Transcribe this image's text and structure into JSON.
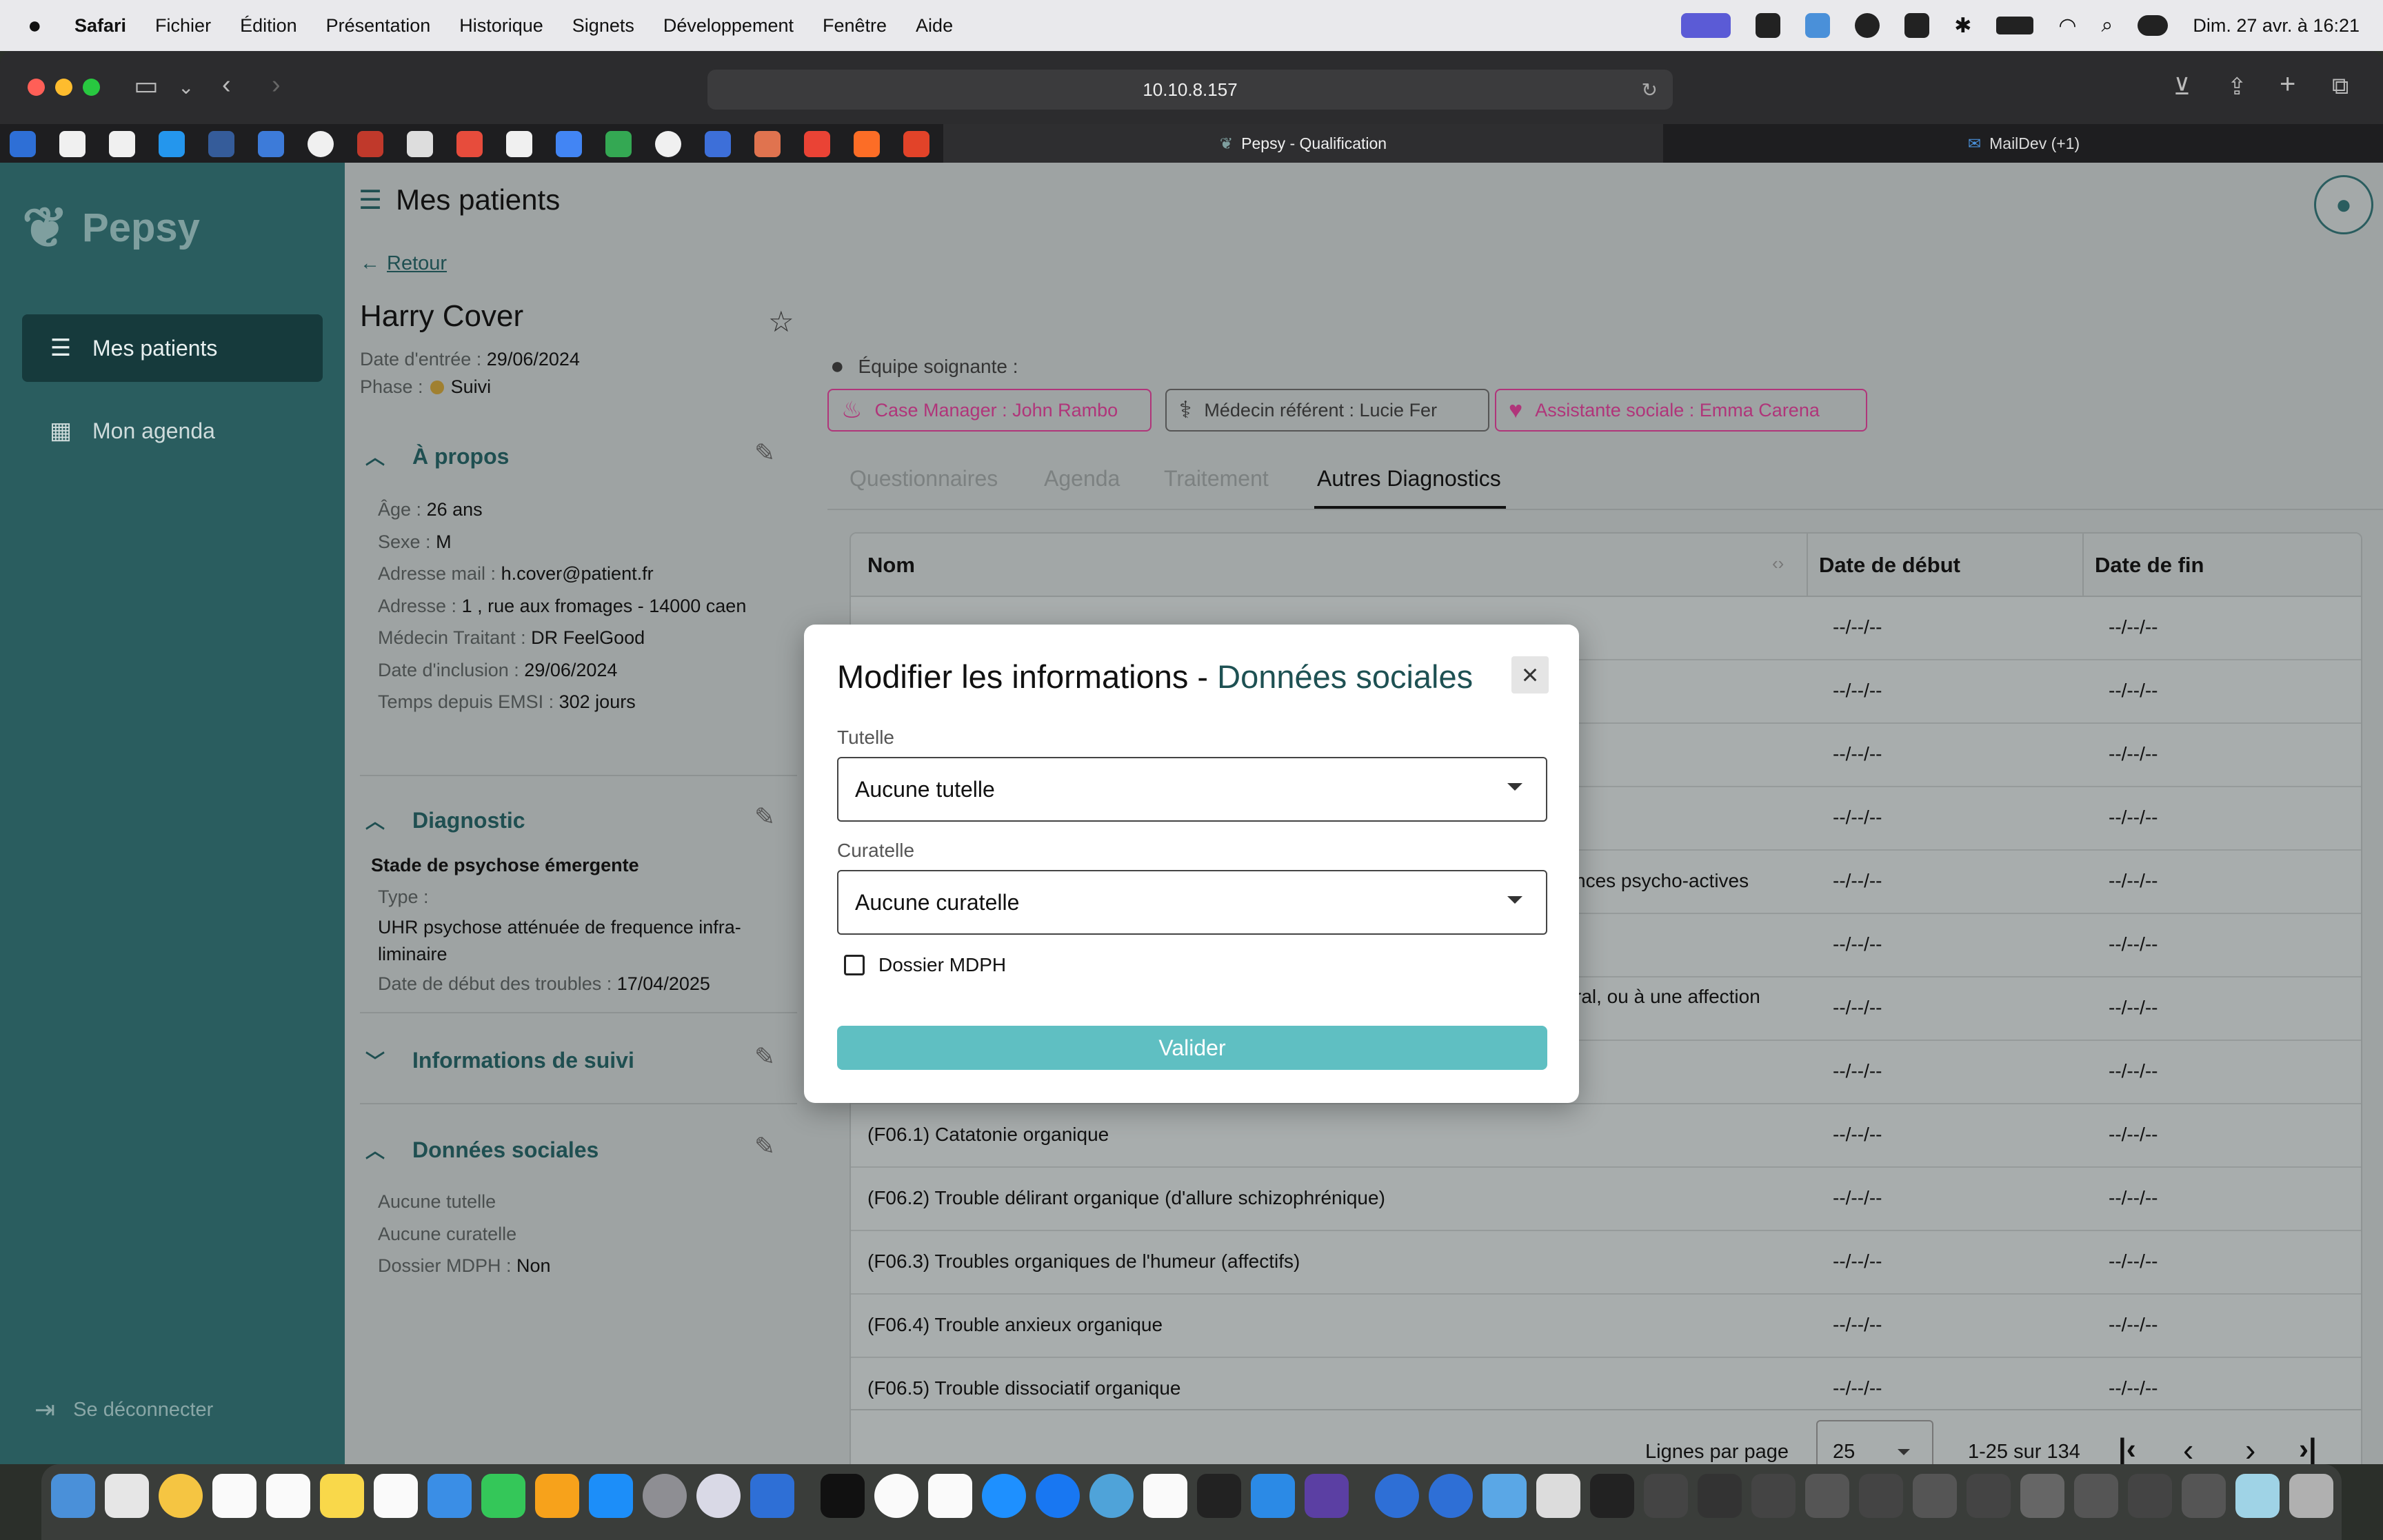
{
  "menubar": {
    "app": "Safari",
    "items": [
      "Fichier",
      "Édition",
      "Présentation",
      "Historique",
      "Signets",
      "Développement",
      "Fenêtre",
      "Aide"
    ],
    "clock": "Dim. 27 avr. à 16:21"
  },
  "browser": {
    "url": "10.10.8.157",
    "tabs": [
      {
        "label": "Pepsy - Qualification"
      },
      {
        "label": "MailDev (+1)"
      }
    ]
  },
  "sidebar": {
    "logo": "Pepsy",
    "items": [
      {
        "label": "Mes patients",
        "icon": "patients-list-icon"
      },
      {
        "label": "Mon agenda",
        "icon": "calendar-icon"
      }
    ],
    "logout": "Se déconnecter"
  },
  "page": {
    "title": "Mes patients",
    "back": "Retour"
  },
  "patient": {
    "name": "Harry Cover",
    "entry_label": "Date d'entrée :",
    "entry_value": "29/06/2024",
    "phase_label": "Phase :",
    "phase_value": "Suivi",
    "apropos": {
      "title": "À propos",
      "fields": [
        {
          "label": "Âge :",
          "value": "26 ans"
        },
        {
          "label": "Sexe :",
          "value": "M"
        },
        {
          "label": "Adresse mail :",
          "value": "h.cover@patient.fr"
        },
        {
          "label": "Adresse :",
          "value": "1 , rue aux fromages - 14000 caen"
        },
        {
          "label": "Médecin Traitant :",
          "value": "DR FeelGood"
        },
        {
          "label": "Date d'inclusion :",
          "value": "29/06/2024"
        },
        {
          "label": "Temps depuis EMSI :",
          "value": "302 jours"
        }
      ]
    },
    "diagnostic": {
      "title": "Diagnostic",
      "stage": "Stade de psychose émergente",
      "type_label": "Type :",
      "type_value_1": "UHR psychose atténuée de frequence infra-",
      "type_value_2": "liminaire",
      "start_label": "Date de début des troubles :",
      "start_value": "17/04/2025"
    },
    "suivi": {
      "title": "Informations de suivi"
    },
    "social": {
      "title": "Données sociales",
      "tutelle": "Aucune tutelle",
      "curatelle": "Aucune curatelle",
      "mdph_label": "Dossier MDPH  :",
      "mdph_value": "Non"
    }
  },
  "team": {
    "label": "Équipe soignante :",
    "chips": [
      {
        "label": "Case Manager : John Rambo",
        "color": "#b0357a"
      },
      {
        "label": "Médecin référent : Lucie Fer",
        "color": "#333333"
      },
      {
        "label": "Assistante sociale : Emma Carena",
        "color": "#b0357a"
      }
    ]
  },
  "tabs": [
    "Questionnaires",
    "Agenda",
    "Traitement",
    "Autres Diagnostics"
  ],
  "table": {
    "headers": [
      "Nom",
      "Date de début",
      "Date de fin"
    ],
    "rows": [
      {
        "name": "",
        "start": "--/--/--",
        "end": "--/--/--"
      },
      {
        "name": "",
        "start": "--/--/--",
        "end": "--/--/--"
      },
      {
        "name": "",
        "start": "--/--/--",
        "end": "--/--/--"
      },
      {
        "name": "",
        "start": "--/--/--",
        "end": "--/--/--"
      },
      {
        "name": "nces psycho-actives",
        "start": "--/--/--",
        "end": "--/--/--"
      },
      {
        "name": "",
        "start": "--/--/--",
        "end": "--/--/--"
      },
      {
        "name": "ral, ou à une affection",
        "start": "--/--/--",
        "end": "--/--/--"
      },
      {
        "name": "",
        "start": "--/--/--",
        "end": "--/--/--"
      },
      {
        "name": "(F06.1) Catatonie organique",
        "start": "--/--/--",
        "end": "--/--/--"
      },
      {
        "name": "(F06.2) Trouble délirant organique (d'allure schizophrénique)",
        "start": "--/--/--",
        "end": "--/--/--"
      },
      {
        "name": "(F06.3) Troubles organiques de l'humeur (affectifs)",
        "start": "--/--/--",
        "end": "--/--/--"
      },
      {
        "name": "(F06.4) Trouble anxieux organique",
        "start": "--/--/--",
        "end": "--/--/--"
      },
      {
        "name": "(F06.5) Trouble dissociatif organique",
        "start": "--/--/--",
        "end": "--/--/--"
      }
    ],
    "pager": {
      "rows_label": "Lignes par page",
      "rows_value": "25",
      "range": "1-25 sur 134"
    }
  },
  "modal": {
    "title_main": "Modifier les informations - ",
    "title_accent": "Données sociales",
    "tutelle_label": "Tutelle",
    "tutelle_value": "Aucune tutelle",
    "curatelle_label": "Curatelle",
    "curatelle_value": "Aucune curatelle",
    "checkbox_label": "Dossier MDPH",
    "submit": "Valider"
  },
  "colors": {
    "sidebar": "#2a5d5f",
    "accent": "#1e5153",
    "button": "#5fbfc2",
    "pink": "#b0357a"
  }
}
